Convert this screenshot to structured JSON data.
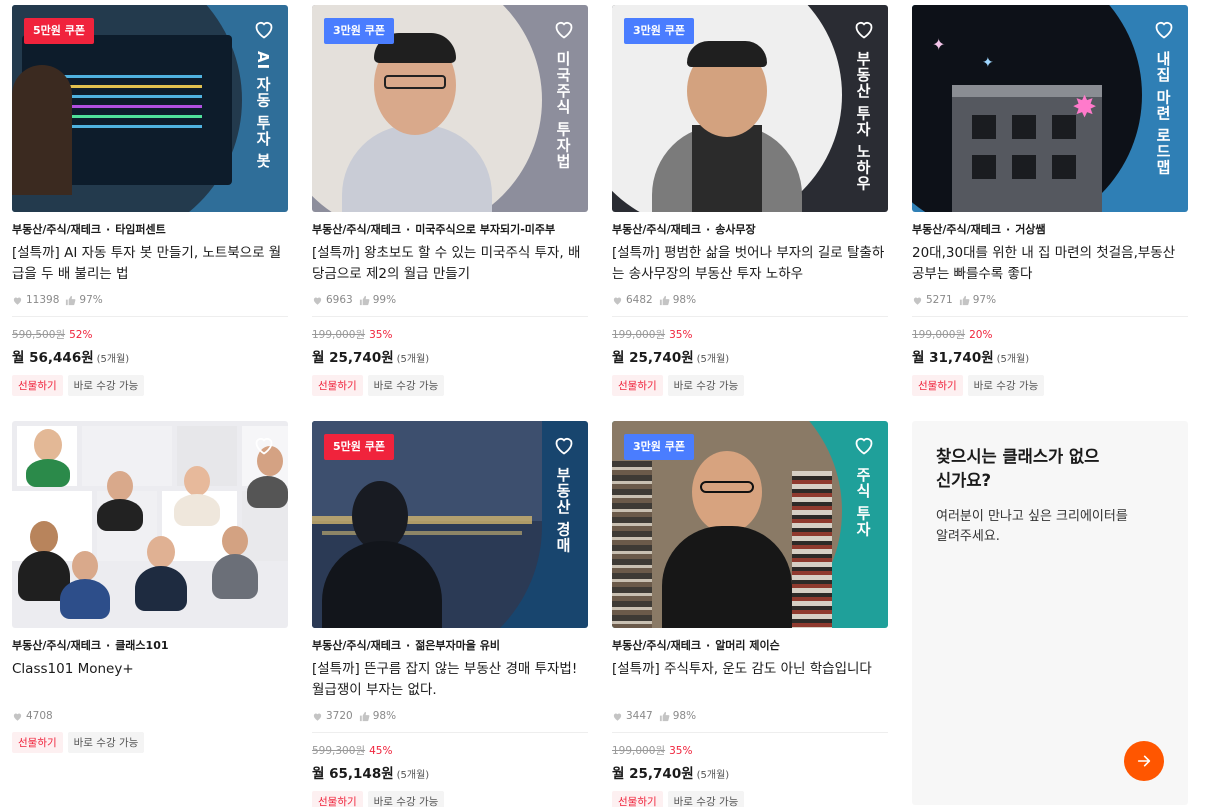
{
  "cards": [
    {
      "coupon": "5만원 쿠폰",
      "coupon_color": "#f0233c",
      "vtitle": "AI 자동 투자 봇",
      "thumb_bg": "#2f6e99",
      "category": "부동산/주식/재테크",
      "creator": "타임퍼센트",
      "title": "[설특까] AI 자동 투자 봇 만들기, 노트북으로 월급을 두 배 불리는 법",
      "likes": "11398",
      "rating": "97%",
      "orig_price": "590,500원",
      "discount": "52%",
      "monthly": "월 56,446원",
      "months": "(5개월)",
      "tag_gift": "선물하기",
      "tag_now": "바로 수강 가능"
    },
    {
      "coupon": "3만원 쿠폰",
      "coupon_color": "#4a7dff",
      "vtitle": "미국주식 투자법",
      "thumb_bg": "#8d8e9c",
      "category": "부동산/주식/재테크",
      "creator": "미국주식으로 부자되기-미주부",
      "title": "[설특까] 왕초보도 할 수 있는 미국주식 투자, 배당금으로 제2의 월급 만들기",
      "likes": "6963",
      "rating": "99%",
      "orig_price": "199,000원",
      "discount": "35%",
      "monthly": "월 25,740원",
      "months": "(5개월)",
      "tag_gift": "선물하기",
      "tag_now": "바로 수강 가능"
    },
    {
      "coupon": "3만원 쿠폰",
      "coupon_color": "#4a7dff",
      "vtitle": "부동산 투자 노하우",
      "thumb_bg": "#2a2c33",
      "category": "부동산/주식/재테크",
      "creator": "송사무장",
      "title": "[설특까] 평범한 삶을 벗어나 부자의 길로 탈출하는 송사무장의 부동산 투자 노하우",
      "likes": "6482",
      "rating": "98%",
      "orig_price": "199,000원",
      "discount": "35%",
      "monthly": "월 25,740원",
      "months": "(5개월)",
      "tag_gift": "선물하기",
      "tag_now": "바로 수강 가능"
    },
    {
      "coupon": "",
      "coupon_color": "",
      "vtitle": "내집 마련 로드맵",
      "thumb_bg": "#2f7fb5",
      "category": "부동산/주식/재테크",
      "creator": "거상쌤",
      "title": "20대,30대를 위한 내 집 마련의 첫걸음,부동산 공부는 빠를수록 좋다",
      "likes": "5271",
      "rating": "97%",
      "orig_price": "199,000원",
      "discount": "20%",
      "monthly": "월 31,740원",
      "months": "(5개월)",
      "tag_gift": "선물하기",
      "tag_now": "바로 수강 가능"
    },
    {
      "coupon": "",
      "coupon_color": "",
      "vtitle": "",
      "thumb_bg": "#ececf0",
      "category": "부동산/주식/재테크",
      "creator": "클래스101",
      "title": "Class101 Money+",
      "likes": "4708",
      "rating": "",
      "orig_price": "",
      "discount": "",
      "monthly": "",
      "months": "",
      "tag_gift": "선물하기",
      "tag_now": "바로 수강 가능"
    },
    {
      "coupon": "5만원 쿠폰",
      "coupon_color": "#f0233c",
      "vtitle": "부동산 경매",
      "thumb_bg": "#18456e",
      "category": "부동산/주식/재테크",
      "creator": "젊은부자마을 유비",
      "title": "[설특까] 뜬구름 잡지 않는 부동산 경매 투자법! 월급쟁이 부자는 없다.",
      "likes": "3720",
      "rating": "98%",
      "orig_price": "599,300원",
      "discount": "45%",
      "monthly": "월 65,148원",
      "months": "(5개월)",
      "tag_gift": "선물하기",
      "tag_now": "바로 수강 가능"
    },
    {
      "coupon": "3만원 쿠폰",
      "coupon_color": "#4a7dff",
      "vtitle": "주식 투자",
      "thumb_bg": "#1fa09a",
      "category": "부동산/주식/재테크",
      "creator": "알머리 제이슨",
      "title": "[설특까] 주식투자, 운도 감도 아닌 학습입니다",
      "likes": "3447",
      "rating": "98%",
      "orig_price": "199,000원",
      "discount": "35%",
      "monthly": "월 25,740원",
      "months": "(5개월)",
      "tag_gift": "선물하기",
      "tag_now": "바로 수강 가능"
    }
  ],
  "request": {
    "title": "찾으시는 클래스가 없으신가요?",
    "desc": "여러분이 만나고 싶은 크리에이터를 알려주세요."
  },
  "colors": {
    "accent": "#ff5600",
    "discount": "#f0233c"
  }
}
